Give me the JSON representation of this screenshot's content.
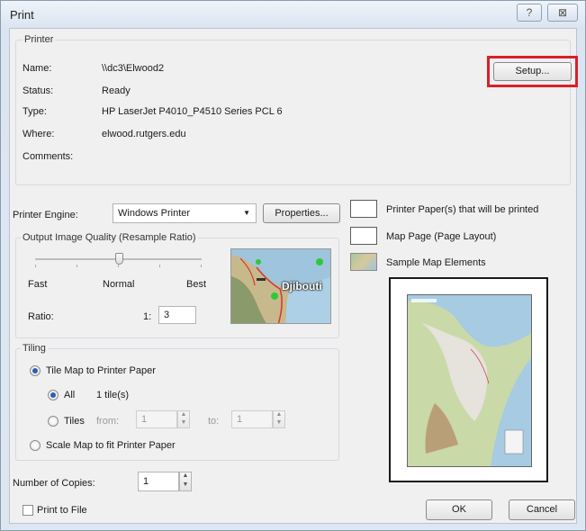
{
  "window": {
    "title": "Print",
    "help_glyph": "?",
    "close_glyph": "⊠"
  },
  "printer": {
    "group_title": "Printer",
    "name_label": "Name:",
    "name_value": "\\\\dc3\\Elwood2",
    "status_label": "Status:",
    "status_value": "Ready",
    "type_label": "Type:",
    "type_value": "HP LaserJet P4010_P4510 Series PCL 6",
    "where_label": "Where:",
    "where_value": "elwood.rutgers.edu",
    "comments_label": "Comments:",
    "comments_value": "",
    "setup_button": "Setup..."
  },
  "engine": {
    "label": "Printer Engine:",
    "selected": "Windows Printer",
    "properties_button": "Properties..."
  },
  "quality": {
    "group_title": "Output Image Quality (Resample Ratio)",
    "fast": "Fast",
    "normal": "Normal",
    "best": "Best",
    "ratio_label": "Ratio:",
    "ratio_prefix": "1:",
    "ratio_value": "3",
    "slider_level": 0.5,
    "preview_label": "Djibouti"
  },
  "legend": {
    "paper": "Printer Paper(s) that will be printed",
    "map_page": "Map Page (Page Layout)",
    "sample": "Sample Map Elements"
  },
  "tiling": {
    "group_title": "Tiling",
    "tile_map": "Tile Map to Printer Paper",
    "all": "All",
    "tile_count": "1 tile(s)",
    "tiles": "Tiles",
    "from_label": "from:",
    "from_value": "1",
    "to_label": "to:",
    "to_value": "1",
    "scale_map": "Scale Map to fit Printer Paper"
  },
  "copies": {
    "label": "Number of Copies:",
    "value": "1"
  },
  "print_to_file": "Print to File",
  "ok_button": "OK",
  "cancel_button": "Cancel",
  "colors": {
    "highlight": "#d8202a",
    "radio_dot": "#2a5fb8"
  }
}
